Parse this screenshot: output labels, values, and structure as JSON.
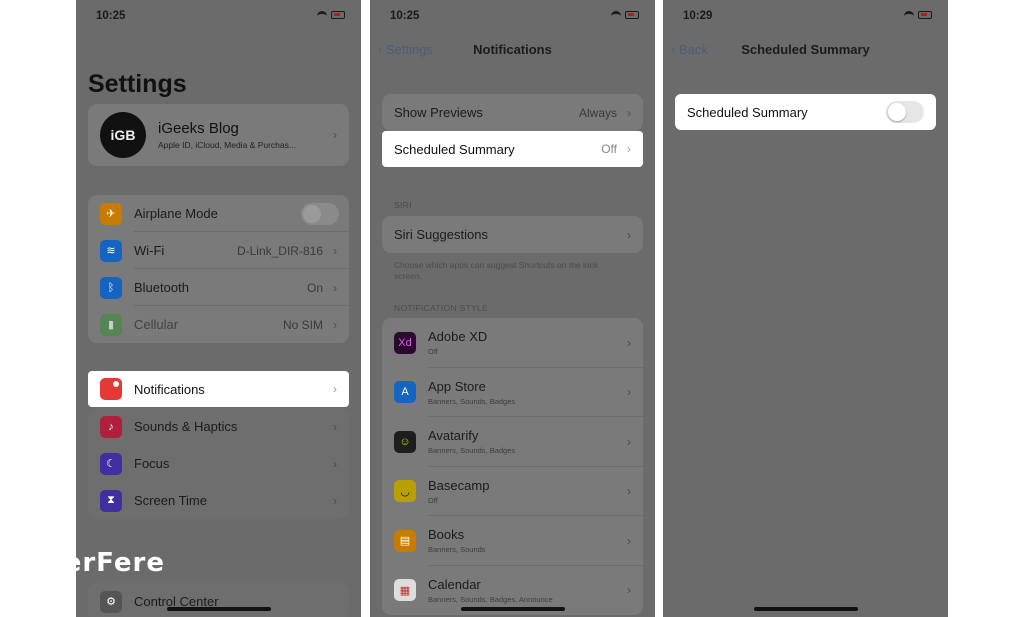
{
  "watermark": "FerFere",
  "colors": {
    "phone_bg": "#6b6b6b",
    "highlight": "#ffffff",
    "notifications_icon": "#e53935"
  },
  "screen1": {
    "time": "10:25",
    "title": "Settings",
    "profile": {
      "initials": "iGB",
      "name": "iGeeks Blog",
      "subtitle": "Apple ID, iCloud, Media & Purchas..."
    },
    "items": [
      {
        "label": "Airplane Mode",
        "value": "",
        "icon": "airplane-icon",
        "color": "#c77b00"
      },
      {
        "label": "Wi-Fi",
        "value": "D-Link_DIR-816",
        "icon": "wifi-icon",
        "color": "#1565c0"
      },
      {
        "label": "Bluetooth",
        "value": "On",
        "icon": "bluetooth-icon",
        "color": "#1565c0"
      },
      {
        "label": "Cellular",
        "value": "No SIM",
        "icon": "cellular-icon",
        "color": "#3d8b3d"
      }
    ],
    "notifications": "Notifications",
    "items2": [
      {
        "label": "Sounds & Haptics",
        "icon": "speaker-icon",
        "color": "#b0203a"
      },
      {
        "label": "Focus",
        "icon": "moon-icon",
        "color": "#3f2fa0"
      },
      {
        "label": "Screen Time",
        "icon": "hourglass-icon",
        "color": "#3f2fa0"
      }
    ],
    "control_center": "Control Center"
  },
  "screen2": {
    "time": "10:25",
    "back": "Settings",
    "title": "Notifications",
    "show_previews": {
      "label": "Show Previews",
      "value": "Always"
    },
    "scheduled_summary": {
      "label": "Scheduled Summary",
      "value": "Off"
    },
    "siri_header": "SIRI",
    "siri_suggestions": "Siri Suggestions",
    "siri_note": "Choose which apps can suggest Shortcuts on the lock screen.",
    "style_header": "NOTIFICATION STYLE",
    "apps": [
      {
        "name": "Adobe XD",
        "sub": "Off",
        "icon": "adobe-xd-icon",
        "color": "#2b0a2f"
      },
      {
        "name": "App Store",
        "sub": "Banners, Sounds, Badges",
        "icon": "app-store-icon",
        "color": "#1565c0"
      },
      {
        "name": "Avatarify",
        "sub": "Banners, Sounds, Badges",
        "icon": "avatarify-icon",
        "color": "#1e1e1e"
      },
      {
        "name": "Basecamp",
        "sub": "Off",
        "icon": "basecamp-icon",
        "color": "#b8a000"
      },
      {
        "name": "Books",
        "sub": "Banners, Sounds",
        "icon": "books-icon",
        "color": "#c77b00"
      },
      {
        "name": "Calendar",
        "sub": "Banners, Sounds, Badges, Announce",
        "icon": "calendar-icon",
        "color": "#dddddd"
      }
    ]
  },
  "screen3": {
    "time": "10:29",
    "back": "Back",
    "title": "Scheduled Summary",
    "toggle_label": "Scheduled Summary"
  }
}
